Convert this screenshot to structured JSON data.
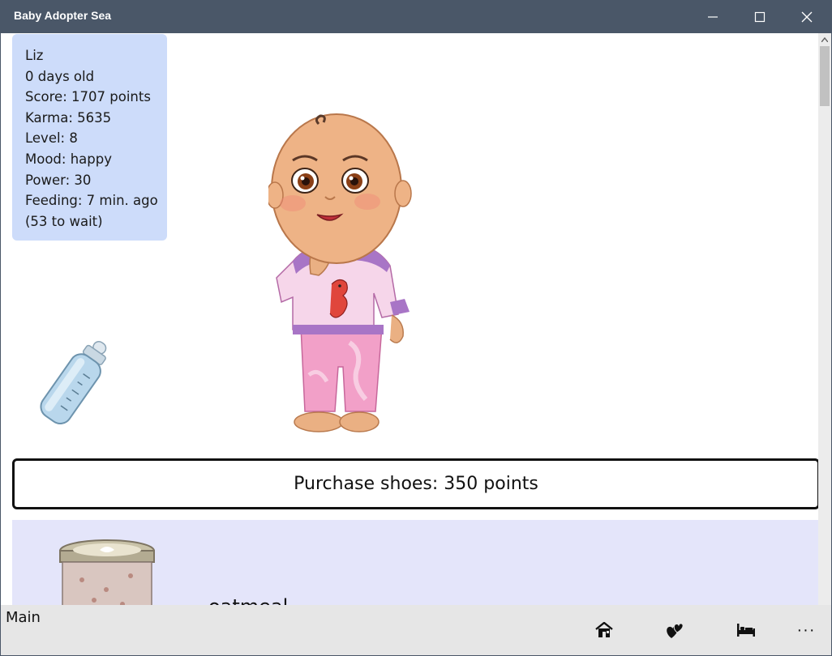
{
  "window": {
    "title": "Baby Adopter Sea"
  },
  "baby": {
    "name": "Liz",
    "age": "0 days old",
    "score": "Score: 1707 points",
    "karma": "Karma: 5635",
    "level": "Level: 8",
    "mood": "Mood: happy",
    "power": "Power: 30",
    "feeding": "Feeding: 7 min. ago",
    "wait": "(53 to wait)"
  },
  "purchase": {
    "label": "Purchase shoes: 350 points"
  },
  "food": {
    "item_label": "oatmeal"
  },
  "appbar": {
    "page_label": "Main",
    "more_label": "···"
  },
  "icons": {
    "home": "home-icon",
    "hearts": "hearts-icon",
    "bed": "bed-icon",
    "more": "more-icon",
    "bottle": "baby-bottle-icon"
  },
  "colors": {
    "titlebar": "#4a5768",
    "info_card": "#cddcfa",
    "food_panel": "#e4e5fa",
    "appbar": "#e6e6e6"
  }
}
